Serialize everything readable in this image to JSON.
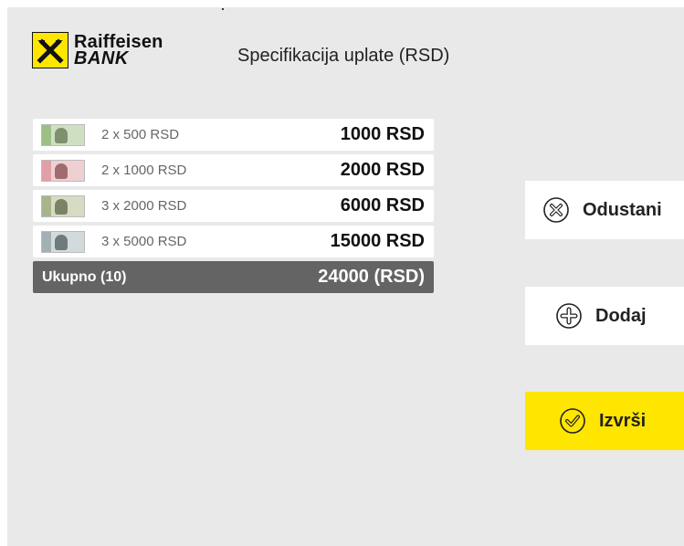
{
  "brand": {
    "name_line1": "Raiffeisen",
    "name_line2": "BANK",
    "accent_color": "#fee600"
  },
  "header": {
    "title": "Specifikacija uplate (RSD)"
  },
  "denominations": [
    {
      "desc": "2 x 500 RSD",
      "amount": "1000 RSD",
      "note_color": "#9cbf86",
      "icon": "banknote-500-icon"
    },
    {
      "desc": "2 x 1000 RSD",
      "amount": "2000 RSD",
      "note_color": "#e0a0a6",
      "icon": "banknote-1000-icon"
    },
    {
      "desc": "3 x 2000 RSD",
      "amount": "6000 RSD",
      "note_color": "#a8b48a",
      "icon": "banknote-2000-icon"
    },
    {
      "desc": "3 x 5000 RSD",
      "amount": "15000 RSD",
      "note_color": "#a3b0b4",
      "icon": "banknote-5000-icon"
    }
  ],
  "total": {
    "label": "Ukupno (10)",
    "amount": "24000 (RSD)",
    "background": "#646464"
  },
  "actions": {
    "cancel": {
      "label": "Odustani",
      "icon": "cancel-circle-icon"
    },
    "add": {
      "label": "Dodaj",
      "icon": "plus-circle-icon"
    },
    "execute": {
      "label": "Izvrši",
      "icon": "check-circle-icon",
      "background": "#fee600"
    }
  }
}
